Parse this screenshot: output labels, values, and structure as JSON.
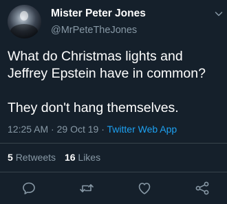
{
  "tweet": {
    "display_name": "Mister Peter Jones",
    "handle": "@MrPeteTheJones",
    "text_line_1": "What do Christmas lights and",
    "text_line_2": "Jeffrey Epstein have in common?",
    "text_line_3": "They don't hang themselves.",
    "time": "12:25 AM",
    "separator_1": "·",
    "date": "29 Oct 19",
    "separator_2": "·",
    "source": "Twitter Web App",
    "retweets_count": "5",
    "retweets_label": "Retweets",
    "likes_count": "16",
    "likes_label": "Likes"
  },
  "icons": {
    "menu": "chevron-down-icon",
    "reply": "reply-icon",
    "retweet": "retweet-icon",
    "like": "heart-icon",
    "share": "share-icon"
  },
  "colors": {
    "background": "#15202b",
    "secondary_text": "#8899a6",
    "link": "#1da1f2",
    "divider": "#38444d"
  }
}
